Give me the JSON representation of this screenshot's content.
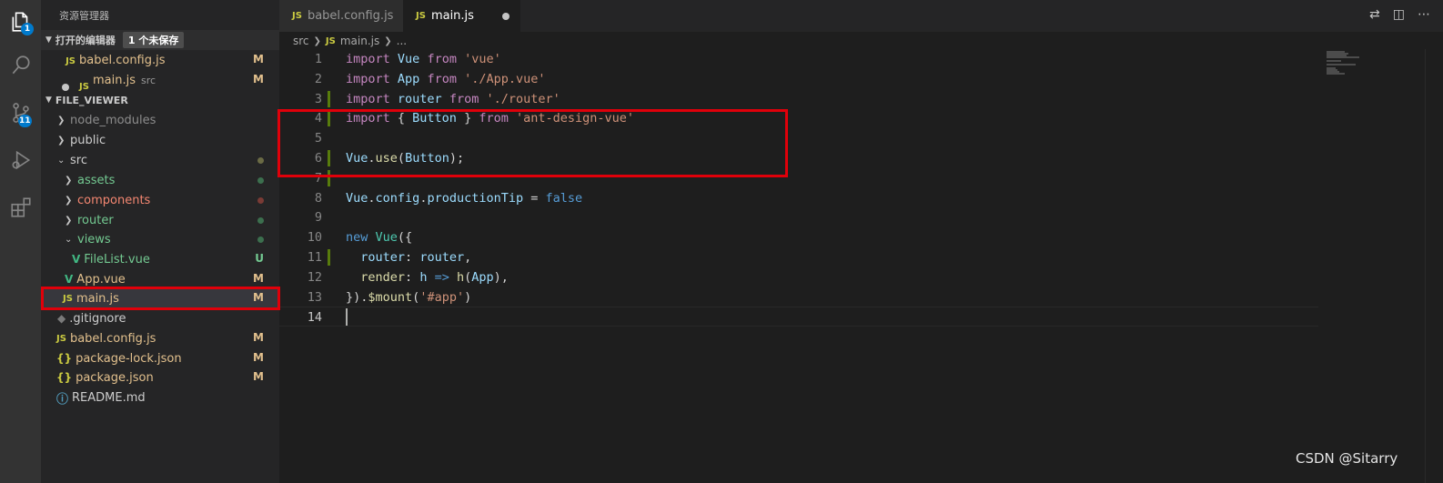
{
  "activity_bar": {
    "explorer_badge": "1",
    "source_control_badge": "11"
  },
  "sidebar": {
    "title": "资源管理器",
    "open_editors": {
      "title": "打开的编辑器",
      "unsaved_badge": "1 个未保存",
      "items": [
        {
          "icon": "JS",
          "label": "babel.config.js",
          "desc": "",
          "status": "M"
        },
        {
          "icon": "JS",
          "label": "main.js",
          "desc": "src",
          "status": "M"
        }
      ]
    },
    "project": {
      "title": "FILE_VIEWER",
      "tree": [
        {
          "label": "node_modules",
          "status": ""
        },
        {
          "label": "public",
          "status": ""
        },
        {
          "label": "src",
          "status": ""
        },
        {
          "label": "assets",
          "status": ""
        },
        {
          "label": "components",
          "status": ""
        },
        {
          "label": "router",
          "status": ""
        },
        {
          "label": "views",
          "status": ""
        },
        {
          "icon": "V",
          "label": "FileList.vue",
          "status": "U"
        },
        {
          "icon": "V",
          "label": "App.vue",
          "status": "M"
        },
        {
          "icon": "JS",
          "label": "main.js",
          "status": "M"
        },
        {
          "icon": "◆",
          "label": ".gitignore",
          "status": ""
        },
        {
          "icon": "JS",
          "label": "babel.config.js",
          "status": "M"
        },
        {
          "icon": "{}",
          "label": "package-lock.json",
          "status": "M"
        },
        {
          "icon": "{}",
          "label": "package.json",
          "status": "M"
        },
        {
          "icon": "ⓘ",
          "label": "README.md",
          "status": ""
        }
      ]
    }
  },
  "tabs": [
    {
      "icon": "JS",
      "label": "babel.config.js"
    },
    {
      "icon": "JS",
      "label": "main.js"
    }
  ],
  "breadcrumb": {
    "folder": "src",
    "file_icon": "JS",
    "file": "main.js",
    "more": "..."
  },
  "editor": {
    "line_numbers": [
      "1",
      "2",
      "3",
      "4",
      "5",
      "6",
      "7",
      "8",
      "9",
      "10",
      "11",
      "12",
      "13",
      "14"
    ],
    "lines": [
      [
        {
          "t": "import",
          "c": "k"
        },
        {
          "t": " ",
          "c": "p"
        },
        {
          "t": "Vue",
          "c": "v"
        },
        {
          "t": " ",
          "c": "p"
        },
        {
          "t": "from",
          "c": "k"
        },
        {
          "t": " ",
          "c": "p"
        },
        {
          "t": "'vue'",
          "c": "s"
        }
      ],
      [
        {
          "t": "import",
          "c": "k"
        },
        {
          "t": " ",
          "c": "p"
        },
        {
          "t": "App",
          "c": "v"
        },
        {
          "t": " ",
          "c": "p"
        },
        {
          "t": "from",
          "c": "k"
        },
        {
          "t": " ",
          "c": "p"
        },
        {
          "t": "'./App.vue'",
          "c": "s"
        }
      ],
      [
        {
          "t": "import",
          "c": "k"
        },
        {
          "t": " ",
          "c": "p"
        },
        {
          "t": "router",
          "c": "v"
        },
        {
          "t": " ",
          "c": "p"
        },
        {
          "t": "from",
          "c": "k"
        },
        {
          "t": " ",
          "c": "p"
        },
        {
          "t": "'./router'",
          "c": "s"
        }
      ],
      [
        {
          "t": "import",
          "c": "k"
        },
        {
          "t": " { ",
          "c": "p"
        },
        {
          "t": "Button",
          "c": "v"
        },
        {
          "t": " } ",
          "c": "p"
        },
        {
          "t": "from",
          "c": "k"
        },
        {
          "t": " ",
          "c": "p"
        },
        {
          "t": "'ant-design-vue'",
          "c": "s"
        }
      ],
      [],
      [
        {
          "t": "Vue",
          "c": "v"
        },
        {
          "t": ".",
          "c": "p"
        },
        {
          "t": "use",
          "c": "f"
        },
        {
          "t": "(",
          "c": "p"
        },
        {
          "t": "Button",
          "c": "v"
        },
        {
          "t": ");",
          "c": "p"
        }
      ],
      [],
      [
        {
          "t": "Vue",
          "c": "v"
        },
        {
          "t": ".",
          "c": "p"
        },
        {
          "t": "config",
          "c": "v"
        },
        {
          "t": ".",
          "c": "p"
        },
        {
          "t": "productionTip",
          "c": "v"
        },
        {
          "t": " = ",
          "c": "p"
        },
        {
          "t": "false",
          "c": "b"
        }
      ],
      [],
      [
        {
          "t": "new",
          "c": "b"
        },
        {
          "t": " ",
          "c": "p"
        },
        {
          "t": "Vue",
          "c": "t"
        },
        {
          "t": "({",
          "c": "p"
        }
      ],
      [
        {
          "t": "  ",
          "c": "p"
        },
        {
          "t": "router",
          "c": "v"
        },
        {
          "t": ": ",
          "c": "p"
        },
        {
          "t": "router",
          "c": "v"
        },
        {
          "t": ",",
          "c": "p"
        }
      ],
      [
        {
          "t": "  ",
          "c": "p"
        },
        {
          "t": "render",
          "c": "f"
        },
        {
          "t": ": ",
          "c": "p"
        },
        {
          "t": "h",
          "c": "v"
        },
        {
          "t": " ",
          "c": "p"
        },
        {
          "t": "=>",
          "c": "b"
        },
        {
          "t": " ",
          "c": "p"
        },
        {
          "t": "h",
          "c": "f"
        },
        {
          "t": "(",
          "c": "p"
        },
        {
          "t": "App",
          "c": "v"
        },
        {
          "t": "),",
          "c": "p"
        }
      ],
      [
        {
          "t": "}).",
          "c": "p"
        },
        {
          "t": "$mount",
          "c": "f"
        },
        {
          "t": "(",
          "c": "p"
        },
        {
          "t": "'#app'",
          "c": "s"
        },
        {
          "t": ")",
          "c": "p"
        }
      ],
      []
    ]
  },
  "watermark": "CSDN @Sitarry",
  "colors": {
    "highlight_box": "#e0000a",
    "gutter_modified": "#587c0c",
    "git_modified": "#e2c08d",
    "git_untracked": "#73c991"
  }
}
